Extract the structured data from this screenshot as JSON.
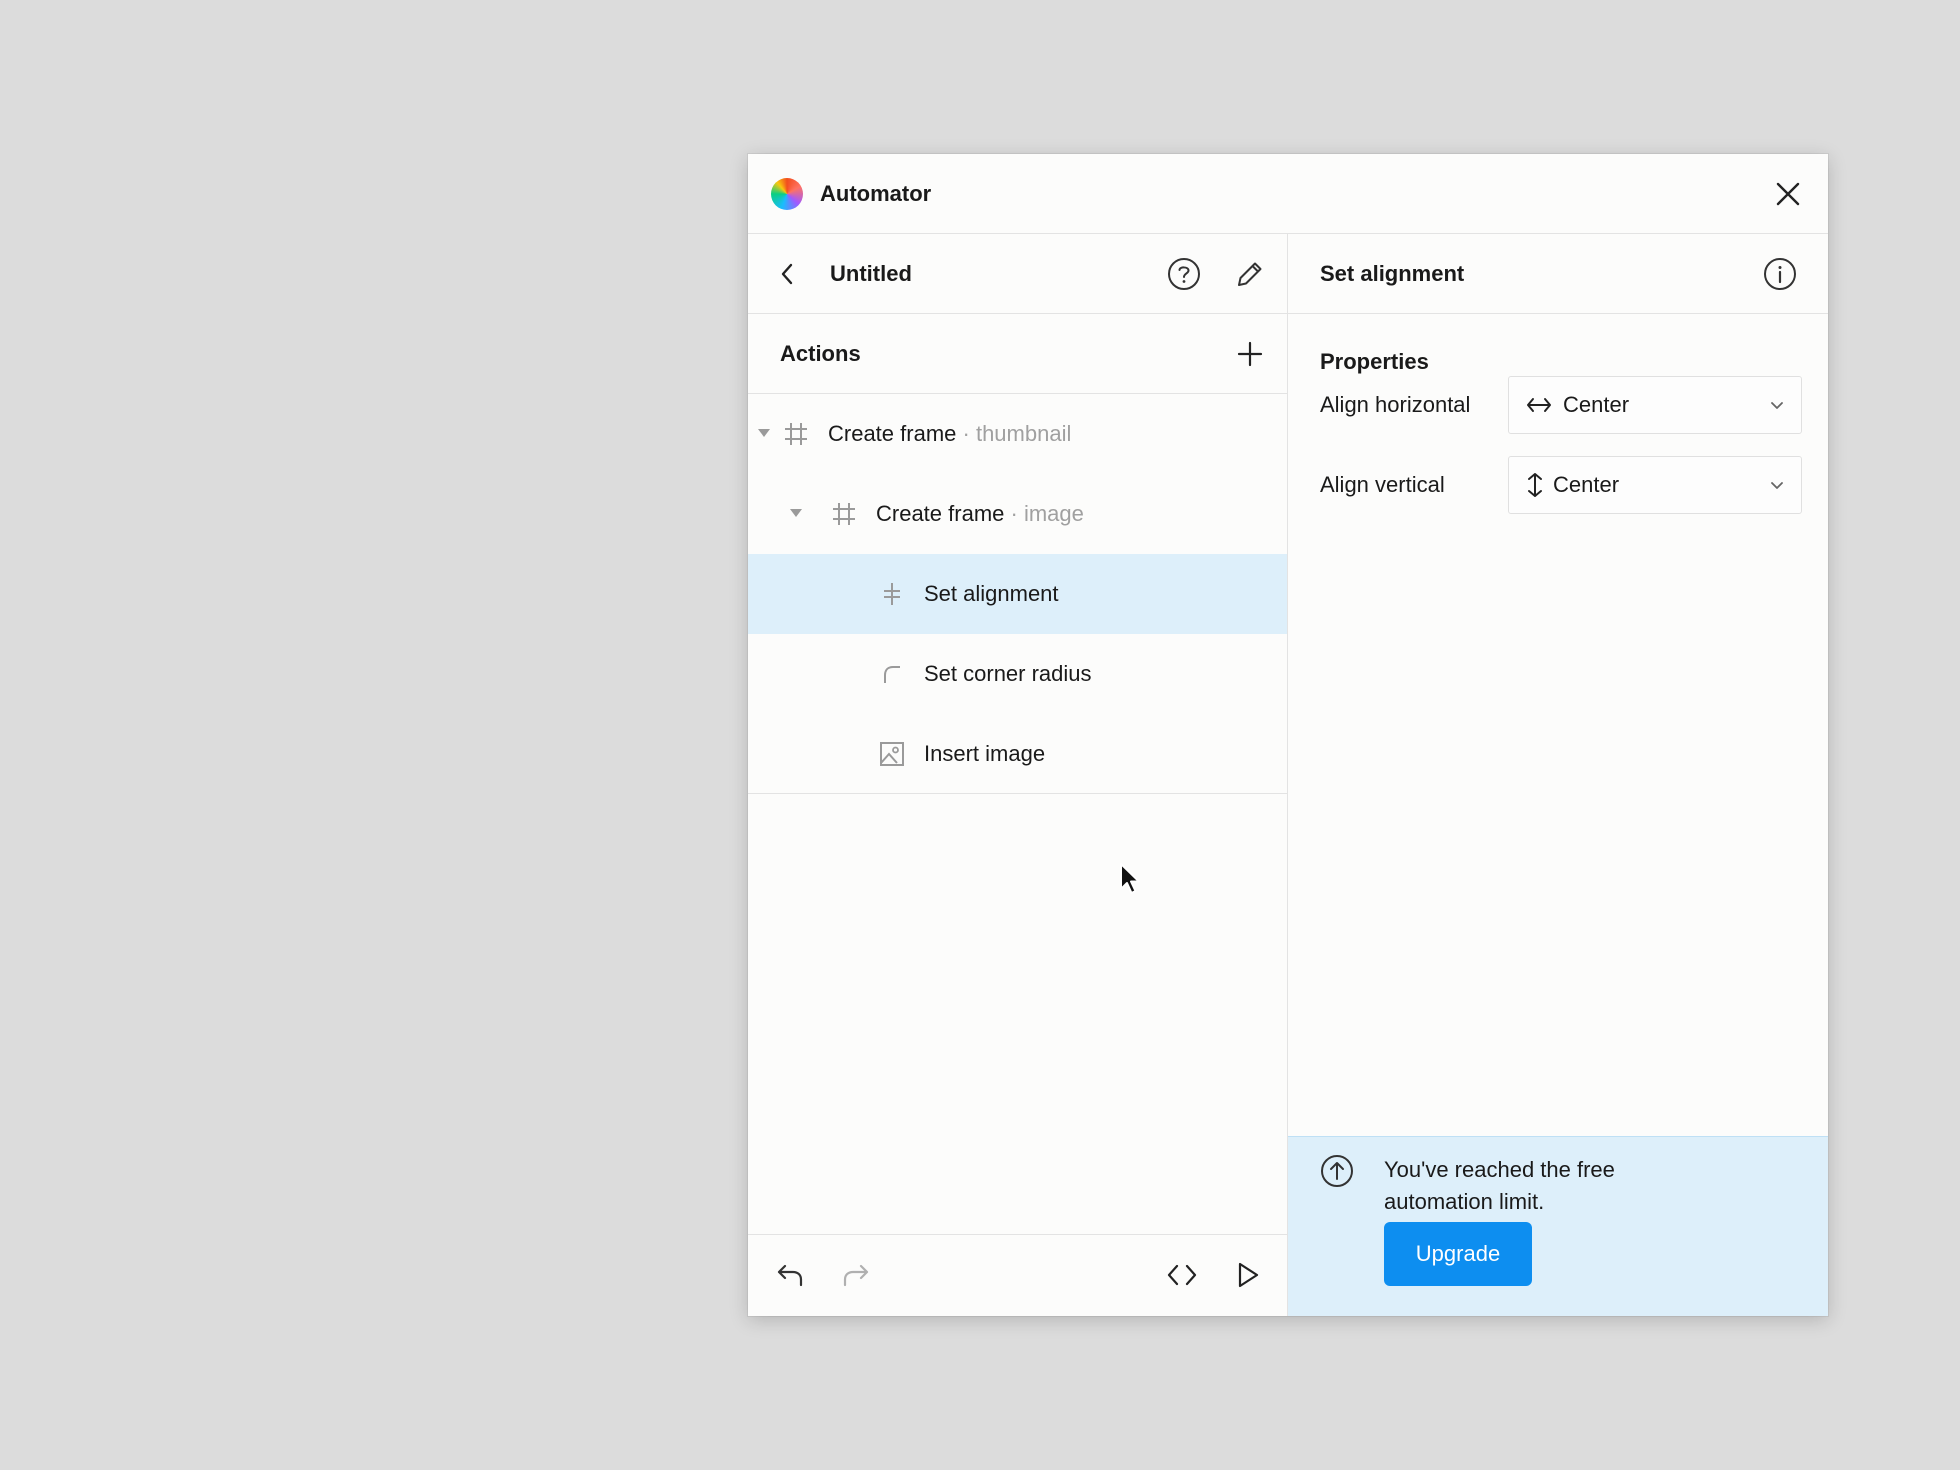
{
  "app": {
    "title": "Automator"
  },
  "left_panel": {
    "document_title": "Untitled",
    "actions_label": "Actions",
    "tree": [
      {
        "label": "Create frame",
        "sublabel": "· thumbnail",
        "icon": "frame-hash-icon",
        "expanded": true,
        "depth": 0
      },
      {
        "label": "Create frame",
        "sublabel": "· image",
        "icon": "frame-hash-icon",
        "expanded": true,
        "depth": 1
      },
      {
        "label": "Set alignment",
        "sublabel": "",
        "icon": "alignment-icon",
        "selected": true,
        "depth": 2
      },
      {
        "label": "Set corner radius",
        "sublabel": "",
        "icon": "corner-radius-icon",
        "depth": 2
      },
      {
        "label": "Insert image",
        "sublabel": "",
        "icon": "image-icon",
        "depth": 2
      }
    ]
  },
  "right_panel": {
    "title": "Set alignment",
    "properties_label": "Properties",
    "properties": [
      {
        "label": "Align horizontal",
        "value": "Center",
        "icon": "horizontal-arrows-icon"
      },
      {
        "label": "Align vertical",
        "value": "Center",
        "icon": "vertical-arrows-icon"
      }
    ]
  },
  "upgrade": {
    "message": "You've reached the free automation limit.",
    "button_label": "Upgrade"
  },
  "colors": {
    "accent": "#0d8ef0",
    "selected_row": "#ddeffa",
    "upgrade_bg": "#ddeffa",
    "background": "#dcdcdc"
  }
}
